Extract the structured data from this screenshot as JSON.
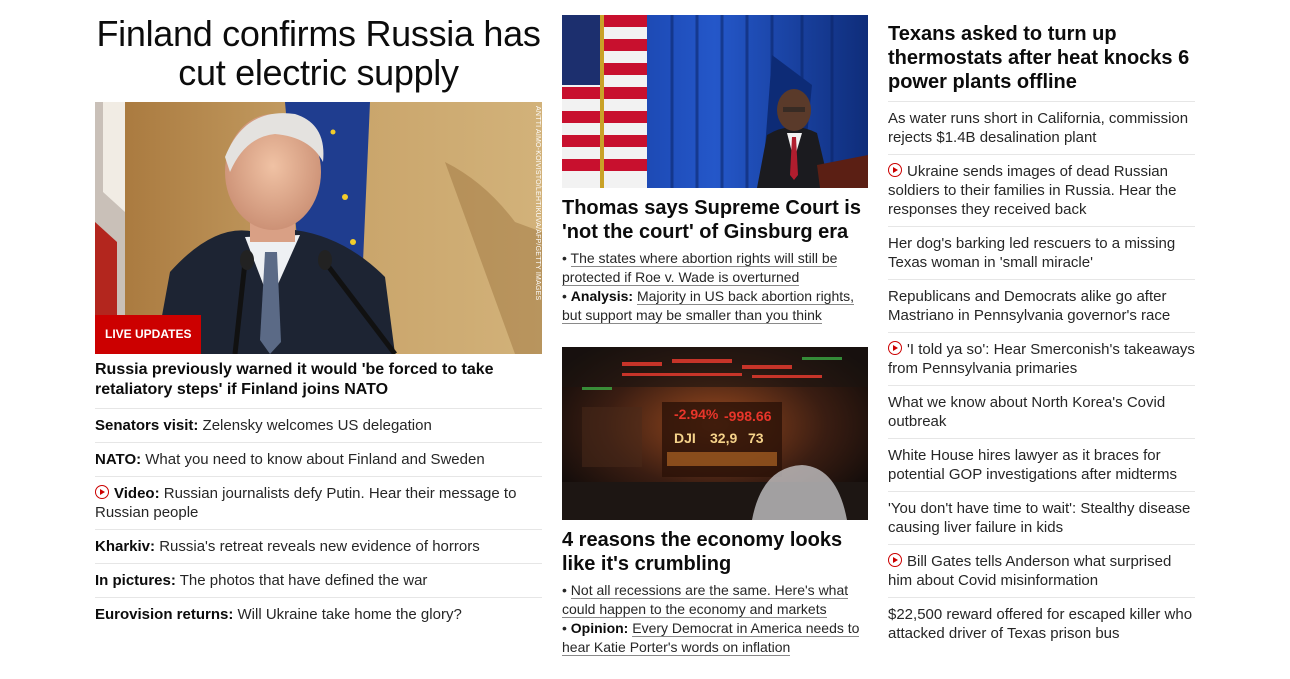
{
  "col1": {
    "headline": "Finland confirms Russia has cut electric supply",
    "image_credit": "ANTTI AIMO-KOIVISTO/LEHTIKUVA/AFP/GETTY IMAGES",
    "badge": "LIVE UPDATES",
    "subhead": "Russia previously warned it would 'be forced to take retaliatory steps' if Finland joins NATO",
    "items": [
      {
        "bold": "Senators visit:",
        "text": " Zelensky welcomes US delegation",
        "video": false
      },
      {
        "bold": "NATO:",
        "text": " What you need to know about Finland and Sweden",
        "video": false
      },
      {
        "bold": "Video:",
        "text": " Russian journalists defy Putin. Hear their message to Russian people",
        "video": true
      },
      {
        "bold": "Kharkiv:",
        "text": " Russia's retreat reveals new evidence of horrors",
        "video": false
      },
      {
        "bold": "In pictures:",
        "text": " The photos that have defined the war",
        "video": false
      },
      {
        "bold": "Eurovision returns:",
        "text": " Will Ukraine take home the glory?",
        "video": false
      }
    ]
  },
  "col2": {
    "card1": {
      "title": "Thomas says Supreme Court is 'not the court' of Ginsburg era",
      "bullet1": "The states where abortion rights will still be protected if Roe v. Wade is overturned",
      "bullet2_bold": "Analysis:",
      "bullet2": "Majority in US back abortion rights, but support may be smaller than you think"
    },
    "card2": {
      "title": "4 reasons the economy looks like it's crumbling",
      "screen_text1": "-2.94%",
      "screen_text2": "-998.66",
      "screen_text3": "DJI",
      "screen_text4": "32,9",
      "screen_text5": "73",
      "bullet1": "Not all recessions are the same. Here's what could happen to the economy and markets",
      "bullet2_bold": "Opinion:",
      "bullet2": "Every Democrat in America needs to hear Katie Porter's words on inflation"
    }
  },
  "col3": {
    "headline": "Texans asked to turn up thermostats after heat knocks 6 power plants offline",
    "items": [
      {
        "text": "As water runs short in California, commission rejects $1.4B desalination plant",
        "video": false
      },
      {
        "text": "Ukraine sends images of dead Russian soldiers to their families in Russia. Hear the responses they received back",
        "video": true
      },
      {
        "text": "Her dog's barking led rescuers to a missing Texas woman in 'small miracle'",
        "video": false
      },
      {
        "text": "Republicans and Democrats alike go after Mastriano in Pennsylvania governor's race",
        "video": false
      },
      {
        "text": "'I told ya so': Hear Smerconish's takeaways from Pennsylvania primaries",
        "video": true
      },
      {
        "text": "What we know about North Korea's Covid outbreak",
        "video": false
      },
      {
        "text": "White House hires lawyer as it braces for potential GOP investigations after midterms",
        "video": false
      },
      {
        "text": "'You don't have time to wait': Stealthy disease causing liver failure in kids",
        "video": false
      },
      {
        "text": "Bill Gates tells Anderson what surprised him about Covid misinformation",
        "video": true
      },
      {
        "text": "$22,500 reward offered for escaped killer who attacked driver of Texas prison bus",
        "video": false
      }
    ]
  },
  "colors": {
    "accent_red": "#cc0000",
    "text": "#0c0c0c",
    "divider": "#e6e6e6"
  },
  "icons": {
    "video": "play-circle-icon"
  }
}
